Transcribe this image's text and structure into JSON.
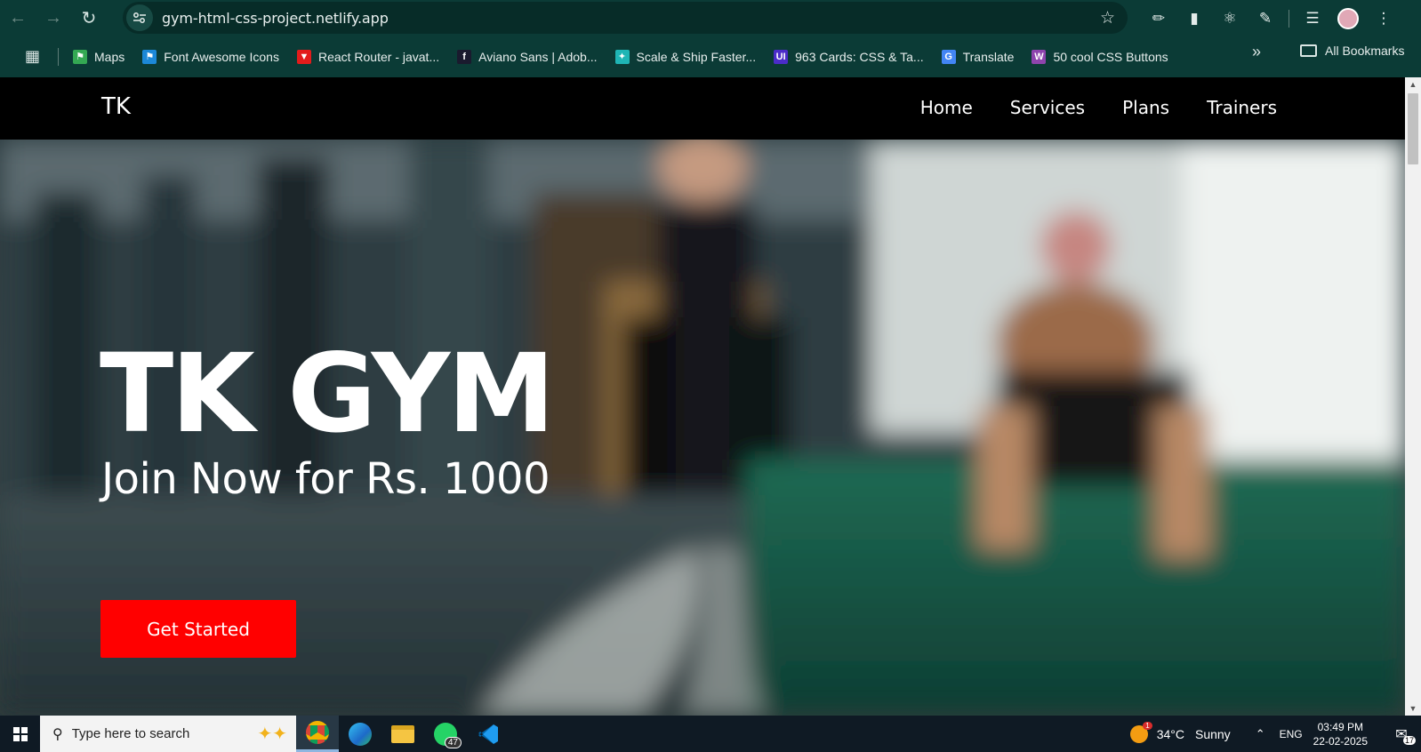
{
  "browser": {
    "url": "gym-html-css-project.netlify.app",
    "bookmarks": [
      {
        "label": "Maps",
        "color": "#34a853",
        "glyph": "⚑"
      },
      {
        "label": "Font Awesome Icons",
        "color": "#1c88d8",
        "glyph": "⚑"
      },
      {
        "label": "React Router - javat...",
        "color": "#e31b1b",
        "glyph": "▼"
      },
      {
        "label": "Aviano Sans | Adob...",
        "color": "#1a1a2e",
        "glyph": "f"
      },
      {
        "label": "Scale & Ship Faster...",
        "color": "#1fb5b5",
        "glyph": "✦"
      },
      {
        "label": "963 Cards: CSS & Ta...",
        "color": "#4b2cc9",
        "glyph": "UI"
      },
      {
        "label": "Translate",
        "color": "#4285f4",
        "glyph": "G"
      },
      {
        "label": "50 cool CSS Buttons",
        "color": "#8e44ad",
        "glyph": "W"
      }
    ],
    "all_bookmarks": "All Bookmarks"
  },
  "site": {
    "logo": "TK",
    "nav": [
      "Home",
      "Services",
      "Plans",
      "Trainers"
    ],
    "hero_title": "TK GYM",
    "hero_subtitle": "Join Now for Rs. 1000",
    "cta": "Get Started",
    "accent": "#ff0000"
  },
  "taskbar": {
    "search_placeholder": "Type here to search",
    "whatsapp_badge": "47",
    "weather_badge": "1",
    "temperature": "34°C",
    "condition": "Sunny",
    "language": "ENG",
    "time": "03:49 PM",
    "date": "22-02-2025",
    "notifications": "17"
  }
}
